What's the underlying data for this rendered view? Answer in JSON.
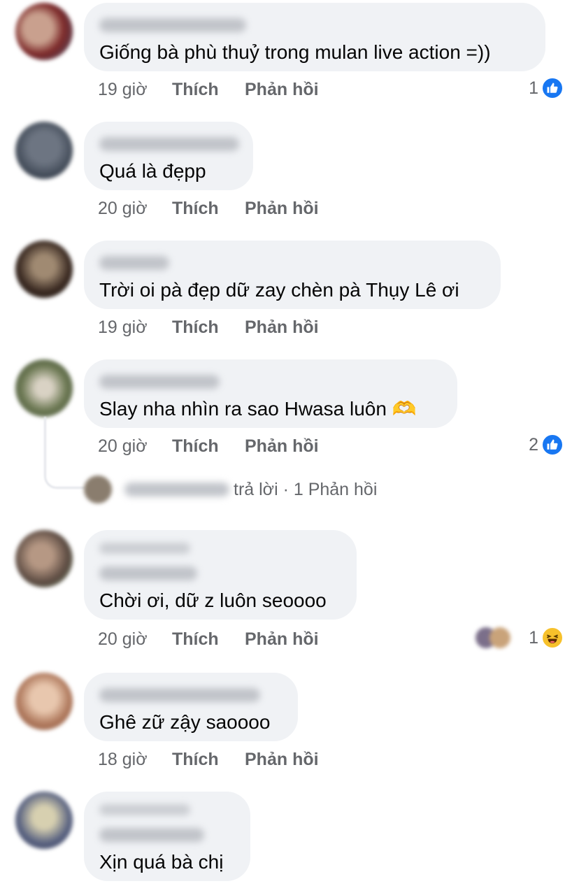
{
  "comments": [
    {
      "text": "Giống bà phù thuỷ trong mulan live action =))",
      "time": "19 giờ",
      "like_label": "Thích",
      "reply_label": "Phản hồi",
      "reaction_count": "1",
      "reaction_icon": "like-icon"
    },
    {
      "text": "Quá là đẹpp",
      "time": "20 giờ",
      "like_label": "Thích",
      "reply_label": "Phản hồi"
    },
    {
      "text": "Trời oi pà đẹp dữ zay chèn pà Thụy Lê ơi",
      "time": "19 giờ",
      "like_label": "Thích",
      "reply_label": "Phản hồi"
    },
    {
      "text": "Slay nha nhìn ra sao Hwasa luôn 🫶",
      "time": "20 giờ",
      "like_label": "Thích",
      "reply_label": "Phản hồi",
      "reaction_count": "2",
      "reaction_icon": "like-icon"
    },
    {
      "text": "Chời ơi, dữ z luôn seoooo",
      "time": "20 giờ",
      "like_label": "Thích",
      "reply_label": "Phản hồi",
      "reaction_count": "1",
      "reaction_icon": "haha-icon"
    },
    {
      "text": "Ghê zữ zậy saoooo",
      "time": "18 giờ",
      "like_label": "Thích",
      "reply_label": "Phản hồi"
    },
    {
      "text": "Xịn quá bà chị"
    }
  ],
  "reply_summary": {
    "text": "trả lời · 1 Phản hồi"
  },
  "colors": {
    "bubble": "#f0f2f5",
    "meta_text": "#65676b",
    "like_blue": "#1877f2",
    "haha_yellow": "#f7c12b"
  }
}
